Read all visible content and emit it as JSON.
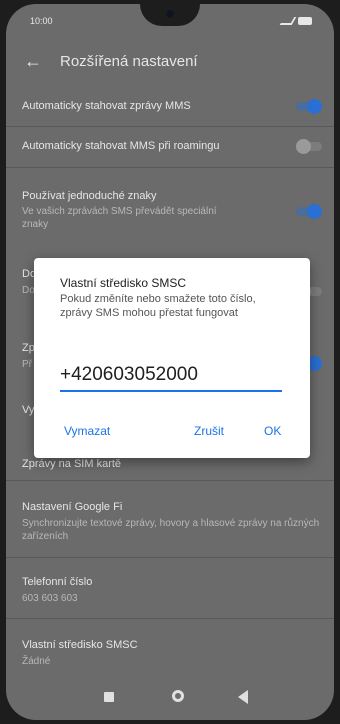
{
  "status": {
    "time": "10:00"
  },
  "appbar": {
    "title": "Rozšířená nastavení"
  },
  "settings": [
    {
      "title": "Automaticky stahovat zprávy MMS",
      "toggle": "on"
    },
    {
      "title": "Automaticky stahovat MMS při roamingu",
      "toggle": "off"
    },
    {
      "title": "Používat jednoduché znaky",
      "subtitle": "Ve vašich zprávách SMS převádět speciální znaky",
      "toggle": "on"
    },
    {
      "title": "Do",
      "subtitle": "Do"
    },
    {
      "title": "Zp",
      "subtitle": "Př"
    },
    {
      "title": "Vy"
    },
    {
      "title": "Zprávy na SIM kartě"
    },
    {
      "title": "Nastavení Google Fi",
      "subtitle": "Synchronizujte textové zprávy, hovory a hlasové zprávy na různých zařízeních"
    },
    {
      "title": "Telefonní číslo",
      "subtitle": "603 603 603"
    },
    {
      "title": "Vlastní středisko SMSC",
      "subtitle": "Žádné"
    }
  ],
  "dialog": {
    "title": "Vlastní středisko SMSC",
    "message": "Pokud změníte nebo smažete toto číslo, zprávy SMS mohou přestat fungovat",
    "value": "+420603052000",
    "clear_label": "Vymazat",
    "cancel_label": "Zrušit",
    "ok_label": "OK"
  },
  "colors": {
    "accent": "#1a73e8",
    "toggle_on": "#2a6fd3"
  },
  "icons": {
    "back": "back-arrow-icon",
    "home": "home-icon",
    "recents": "recents-icon",
    "nav_back": "nav-back-icon"
  }
}
